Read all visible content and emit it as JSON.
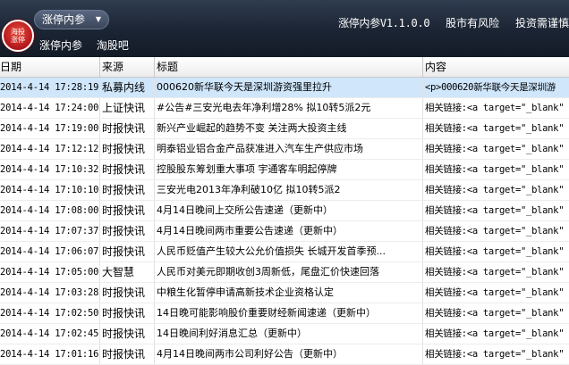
{
  "header": {
    "logo_lines": [
      "海投",
      "涨停"
    ],
    "tab_label": "涨停内参",
    "nav": [
      "涨停内参",
      "淘股吧"
    ],
    "version": "涨停内参V1.1.0.0",
    "risk": "股市有风险",
    "caution": "投资需谨慎"
  },
  "table": {
    "columns": [
      "日期",
      "来源",
      "标题",
      "内容"
    ],
    "rows": [
      {
        "date": "2014-4-14 17:28:19",
        "source": "私募内线",
        "title": "000620新华联今天是深圳游资强里拉升",
        "content": "<p>000620新华联今天是深圳游"
      },
      {
        "date": "2014-4-14 17:24:00",
        "source": "上证快讯",
        "title": "#公告#三安光电去年净利增28% 拟10转5派2元",
        "content": "相关链接:<a target=\"_blank\""
      },
      {
        "date": "2014-4-14 17:19:00",
        "source": "时报快讯",
        "title": "新兴产业崛起的趋势不变 关注两大投资主线",
        "content": "相关链接:<a target=\"_blank\""
      },
      {
        "date": "2014-4-14 17:12:12",
        "source": "时报快讯",
        "title": "明泰铝业铝合金产品获准进入汽车生产供应市场",
        "content": "相关链接:<a target=\"_blank\""
      },
      {
        "date": "2014-4-14 17:10:32",
        "source": "时报快讯",
        "title": "控股股东筹划重大事项 宇通客车明起停牌",
        "content": "相关链接:<a target=\"_blank\""
      },
      {
        "date": "2014-4-14 17:10:10",
        "source": "时报快讯",
        "title": "三安光电2013年净利破10亿 拟10转5派2",
        "content": "相关链接:<a target=\"_blank\""
      },
      {
        "date": "2014-4-14 17:08:00",
        "source": "时报快讯",
        "title": "4月14日晚间上交所公告速递（更新中）",
        "content": "相关链接:<a target=\"_blank\""
      },
      {
        "date": "2014-4-14 17:07:37",
        "source": "时报快讯",
        "title": "4月14日晚间两市重要公告速递（更新中）",
        "content": "相关链接:<a target=\"_blank\""
      },
      {
        "date": "2014-4-14 17:06:07",
        "source": "时报快讯",
        "title": "人民币贬值产生较大公允价值损失 长城开发首季预...",
        "content": "相关链接:<a target=\"_blank\""
      },
      {
        "date": "2014-4-14 17:05:00",
        "source": "大智慧",
        "title": "人民币对美元即期收创3周新低，尾盘汇价快速回落",
        "content": "相关链接:<a target=\"_blank\""
      },
      {
        "date": "2014-4-14 17:03:28",
        "source": "时报快讯",
        "title": "中粮生化暂停申请高新技术企业资格认定",
        "content": "相关链接:<a target=\"_blank\""
      },
      {
        "date": "2014-4-14 17:02:50",
        "source": "时报快讯",
        "title": "14日晚可能影响股价重要财经新闻速递（更新中）",
        "content": "相关链接:<a target=\"_blank\""
      },
      {
        "date": "2014-4-14 17:02:45",
        "source": "时报快讯",
        "title": "14日晚间利好消息汇总（更新中）",
        "content": "相关链接:<a target=\"_blank\""
      },
      {
        "date": "2014-4-14 17:01:16",
        "source": "时报快讯",
        "title": "4月14日晚间两市公司利好公告（更新中）",
        "content": "相关链接:<a target=\"_blank\""
      }
    ],
    "selected_index": 0
  },
  "colors": {
    "header_bg": "#1b2433",
    "selected_row": "#cfe6fb",
    "logo_red": "#c0171c"
  }
}
